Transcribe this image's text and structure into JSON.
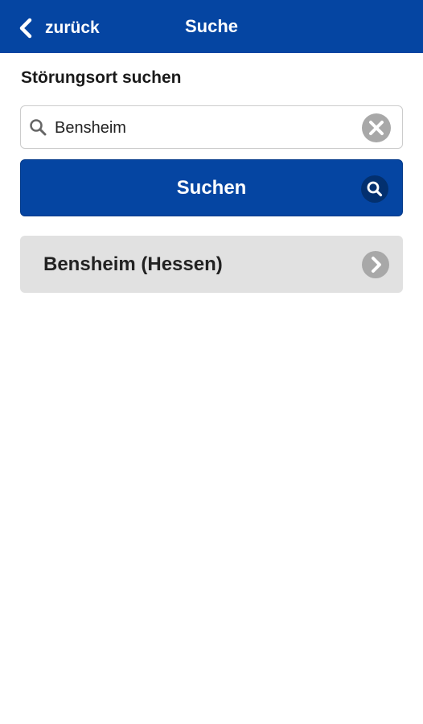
{
  "header": {
    "back_label": "zurück",
    "title": "Suche"
  },
  "search": {
    "section_label": "Störungsort suchen",
    "value": "Bensheim",
    "icon": "search-icon",
    "clear_icon": "clear-icon"
  },
  "search_button": {
    "label": "Suchen",
    "icon": "search-icon"
  },
  "results": [
    {
      "label": "Bensheim (Hessen)",
      "icon": "chevron-right-icon"
    }
  ],
  "colors": {
    "primary": "#0545a2",
    "result_bg": "#e1e1e1",
    "icon_gray": "#a8a8a8"
  }
}
